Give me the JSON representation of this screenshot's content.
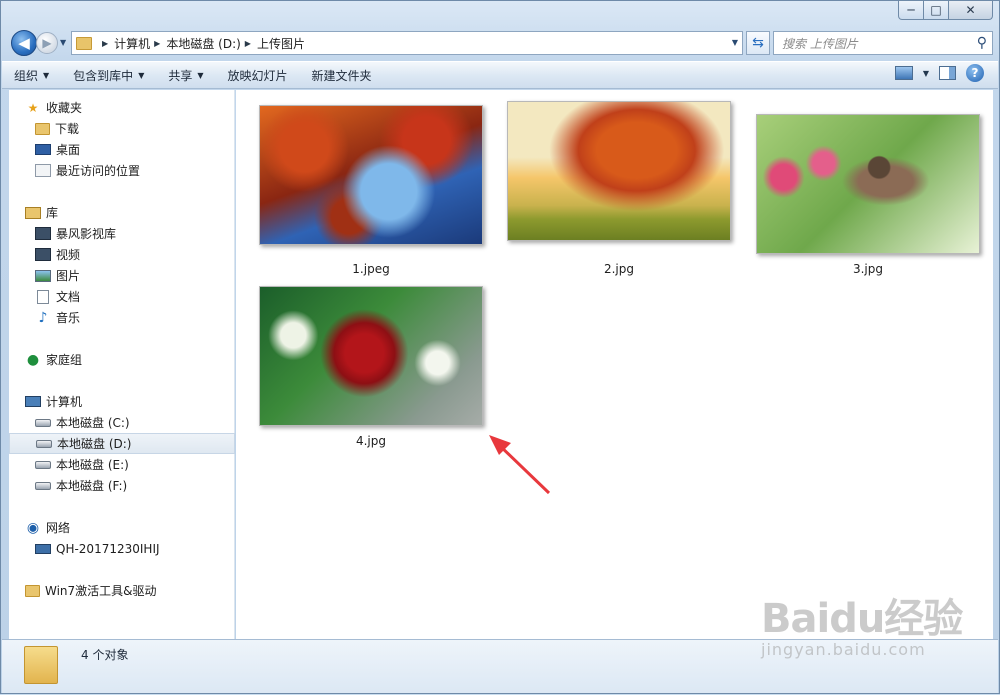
{
  "window": {
    "caption": {
      "minimize": "─",
      "maximize": "□",
      "close": "✕"
    }
  },
  "address": {
    "crumbs": [
      "计算机",
      "本地磁盘 (D:)",
      "上传图片"
    ],
    "search_placeholder": "搜索 上传图片"
  },
  "toolbar": {
    "organize": "组织",
    "include_library": "包含到库中",
    "share": "共享",
    "slideshow": "放映幻灯片",
    "new_folder": "新建文件夹"
  },
  "nav": {
    "favorites": "收藏夹",
    "downloads": "下载",
    "desktop": "桌面",
    "recent": "最近访问的位置",
    "libraries": "库",
    "storm": "暴风影视库",
    "videos": "视频",
    "pictures": "图片",
    "documents": "文档",
    "music": "音乐",
    "homegroup": "家庭组",
    "computer": "计算机",
    "drive_c": "本地磁盘 (C:)",
    "drive_d": "本地磁盘 (D:)",
    "drive_e": "本地磁盘 (E:)",
    "drive_f": "本地磁盘 (F:)",
    "network": "网络",
    "pc": "QH-20171230IHIJ",
    "win7": "Win7激活工具&驱动"
  },
  "files": [
    "1.jpeg",
    "2.jpg",
    "3.jpg",
    "4.jpg"
  ],
  "details": {
    "count": "4 个对象"
  },
  "watermark": {
    "brand": "Baidu经验",
    "url": "jingyan.baidu.com"
  },
  "colors": {
    "accent": "#2a6fc0",
    "arrow": "#e8383d",
    "selection": "#dfe8f1"
  }
}
